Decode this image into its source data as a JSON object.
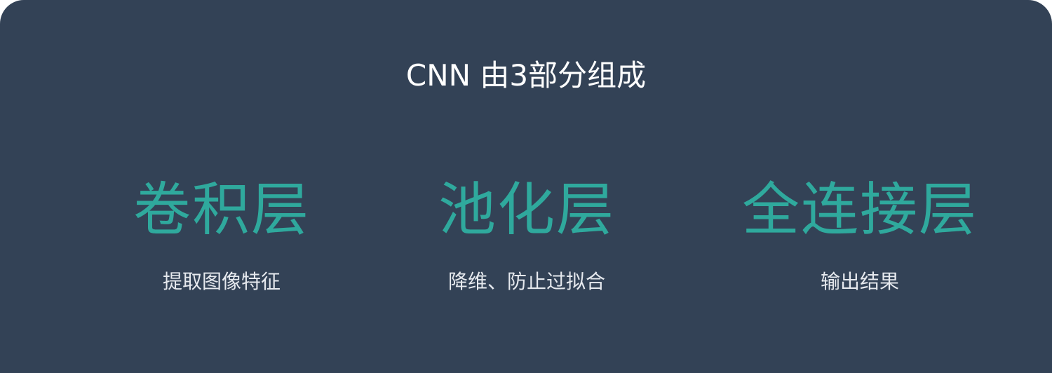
{
  "title": "CNN 由3部分组成",
  "colors": {
    "background": "#334256",
    "accent": "#2fa99d",
    "title_text": "#ffffff",
    "desc_text": "#e6e9ee"
  },
  "layers": [
    {
      "name": "卷积层",
      "description": "提取图像特征"
    },
    {
      "name": "池化层",
      "description": "降维、防止过拟合"
    },
    {
      "name": "全连接层",
      "description": "输出结果"
    }
  ]
}
